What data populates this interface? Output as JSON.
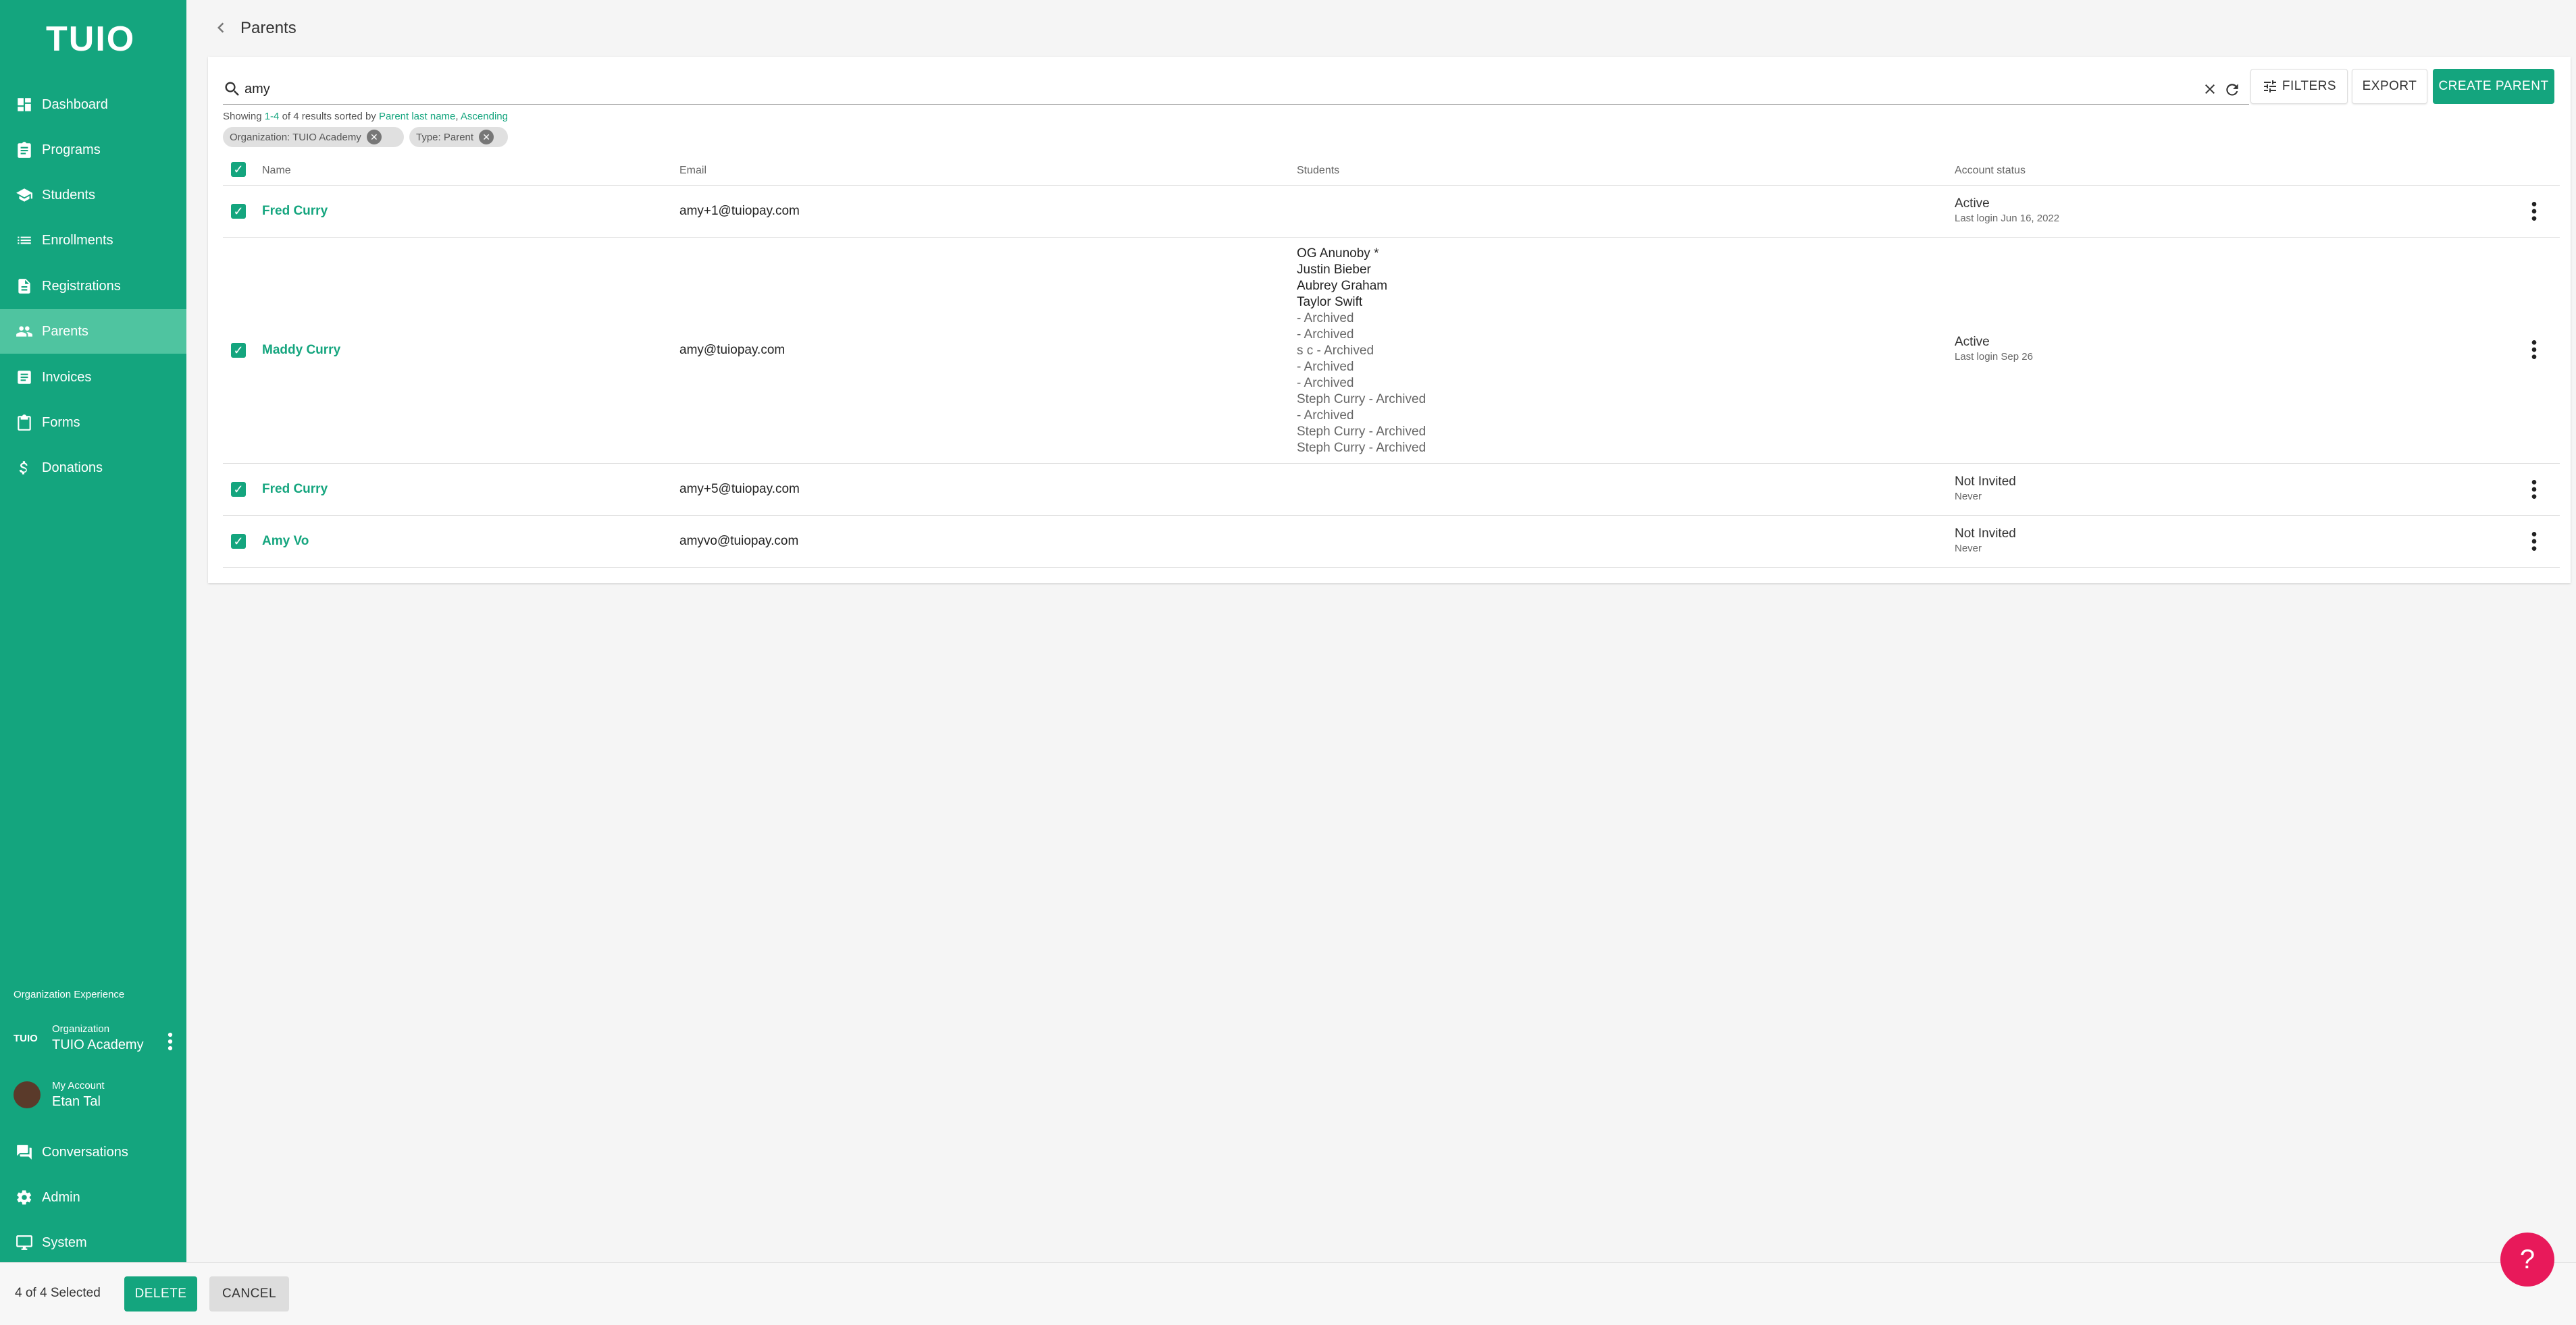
{
  "app": {
    "logo_text": "TUIO",
    "brand_color": "#14a57e",
    "accent_color": "#e8195a"
  },
  "sidebar": {
    "items": [
      {
        "label": "Dashboard",
        "icon": "dashboard-icon"
      },
      {
        "label": "Programs",
        "icon": "clipboard-icon"
      },
      {
        "label": "Students",
        "icon": "graduation-cap-icon"
      },
      {
        "label": "Enrollments",
        "icon": "list-icon"
      },
      {
        "label": "Registrations",
        "icon": "document-icon"
      },
      {
        "label": "Parents",
        "icon": "people-icon",
        "active": true
      },
      {
        "label": "Invoices",
        "icon": "receipt-icon"
      },
      {
        "label": "Forms",
        "icon": "clipboard-icon"
      },
      {
        "label": "Donations",
        "icon": "dollar-icon"
      }
    ],
    "org_experience_label": "Organization Experience",
    "organization": {
      "logo_text": "TUIO",
      "label": "Organization",
      "name": "TUIO Academy"
    },
    "account": {
      "label": "My Account",
      "name": "Etan Tal"
    },
    "bottom_items": [
      {
        "label": "Conversations",
        "icon": "chat-icon"
      },
      {
        "label": "Admin",
        "icon": "gear-icon"
      },
      {
        "label": "System",
        "icon": "monitor-icon"
      }
    ]
  },
  "header": {
    "title": "Parents"
  },
  "toolbar": {
    "search_value": "amy",
    "filters_label": "FILTERS",
    "export_label": "EXPORT",
    "create_label": "CREATE PARENT"
  },
  "summary": {
    "prefix": "Showing ",
    "range": "1-4",
    "middle": " of 4 results sorted by ",
    "sort_field": "Parent last name",
    "comma": ", ",
    "sort_order": "Ascending"
  },
  "chips": [
    "Organization: TUIO Academy",
    "Type: Parent"
  ],
  "table": {
    "columns": [
      "Name",
      "Email",
      "Students",
      "Account status"
    ],
    "rows": [
      {
        "name": "Fred Curry",
        "email": "amy+1@tuiopay.com",
        "students": [],
        "status": "Active",
        "status_sub": "Last login Jun 16, 2022"
      },
      {
        "name": "Maddy Curry",
        "email": "amy@tuiopay.com",
        "students": [
          "OG Anunoby *",
          "Justin Bieber",
          "Aubrey Graham",
          "Taylor Swift",
          " - Archived",
          " - Archived",
          "s c - Archived",
          " - Archived",
          " - Archived",
          "Steph Curry - Archived",
          " - Archived",
          "Steph Curry - Archived",
          "Steph Curry - Archived"
        ],
        "status": "Active",
        "status_sub": "Last login Sep 26"
      },
      {
        "name": "Fred Curry",
        "email": "amy+5@tuiopay.com",
        "students": [],
        "status": "Not Invited",
        "status_sub": "Never"
      },
      {
        "name": "Amy Vo",
        "email": "amyvo@tuiopay.com",
        "students": [],
        "status": "Not Invited",
        "status_sub": "Never"
      }
    ]
  },
  "bottom_bar": {
    "selected_text": "4 of 4 Selected",
    "delete_label": "DELETE",
    "cancel_label": "CANCEL"
  },
  "help": {
    "label": "?"
  }
}
